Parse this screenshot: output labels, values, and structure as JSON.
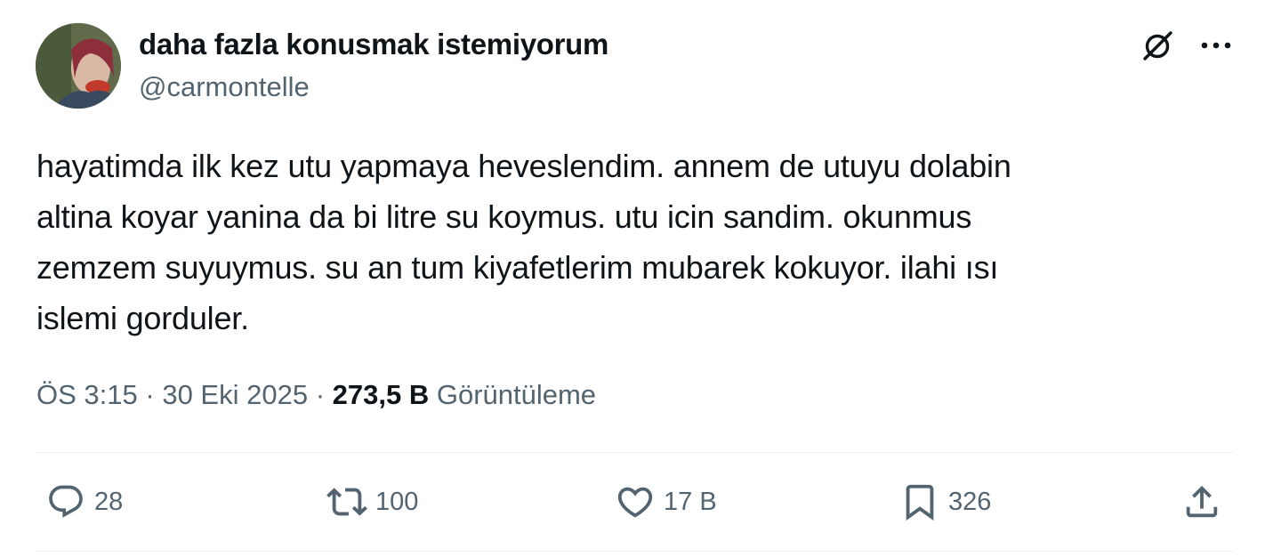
{
  "author": {
    "display_name": "daha fazla konusmak istemiyorum",
    "handle": "@carmontelle"
  },
  "header_icons": {
    "grok": "grok-icon",
    "more": "more-icon"
  },
  "tweet": {
    "text": "hayatimda ilk kez utu yapmaya heveslendim. annem de utuyu dolabin\naltina koyar yanina da bi litre su koymus. utu icin sandim. okunmus\nzemzem suyuymus. su an tum kiyafetlerim mubarek kokuyor. ilahi ısı\nislemi gorduler."
  },
  "meta": {
    "time": "ÖS 3:15",
    "separator": "·",
    "date": "30 Eki 2025",
    "views_count": "273,5 B",
    "views_label": "Görüntüleme"
  },
  "actions": {
    "reply": {
      "icon": "reply-icon",
      "count": "28"
    },
    "retweet": {
      "icon": "retweet-icon",
      "count": "100"
    },
    "like": {
      "icon": "heart-icon",
      "count": "17 B"
    },
    "bookmark": {
      "icon": "bookmark-icon",
      "count": "326"
    },
    "share": {
      "icon": "share-icon"
    }
  },
  "colors": {
    "text": "#0f1419",
    "secondary": "#536471",
    "divider": "#eff3f4"
  }
}
